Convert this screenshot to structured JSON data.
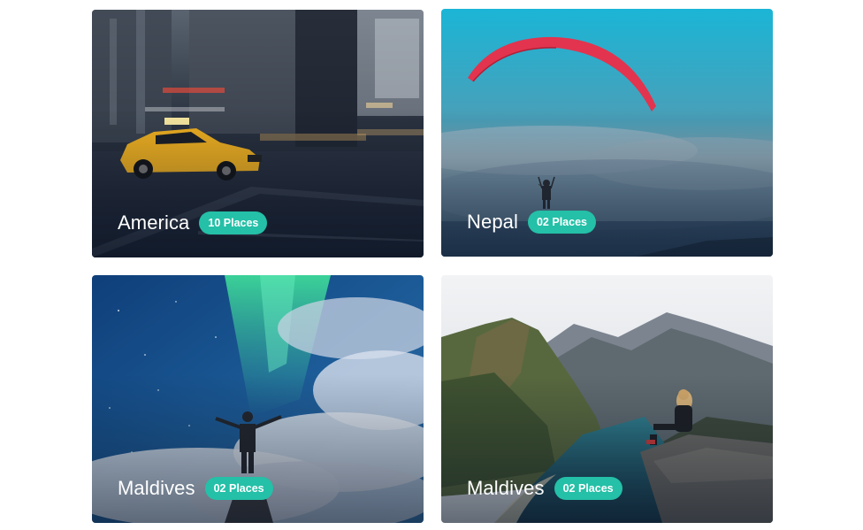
{
  "destinations": [
    {
      "name": "America",
      "places": "10 Places",
      "image": "city-taxi-image"
    },
    {
      "name": "Nepal",
      "places": "02 Places",
      "image": "paragliding-image"
    },
    {
      "name": "Maldives",
      "places": "02 Places",
      "image": "aurora-image"
    },
    {
      "name": "Maldives",
      "places": "02 Places",
      "image": "mountain-lake-image"
    }
  ],
  "colors": {
    "badge": "#24c0a7",
    "caption_text": "#ffffff"
  }
}
